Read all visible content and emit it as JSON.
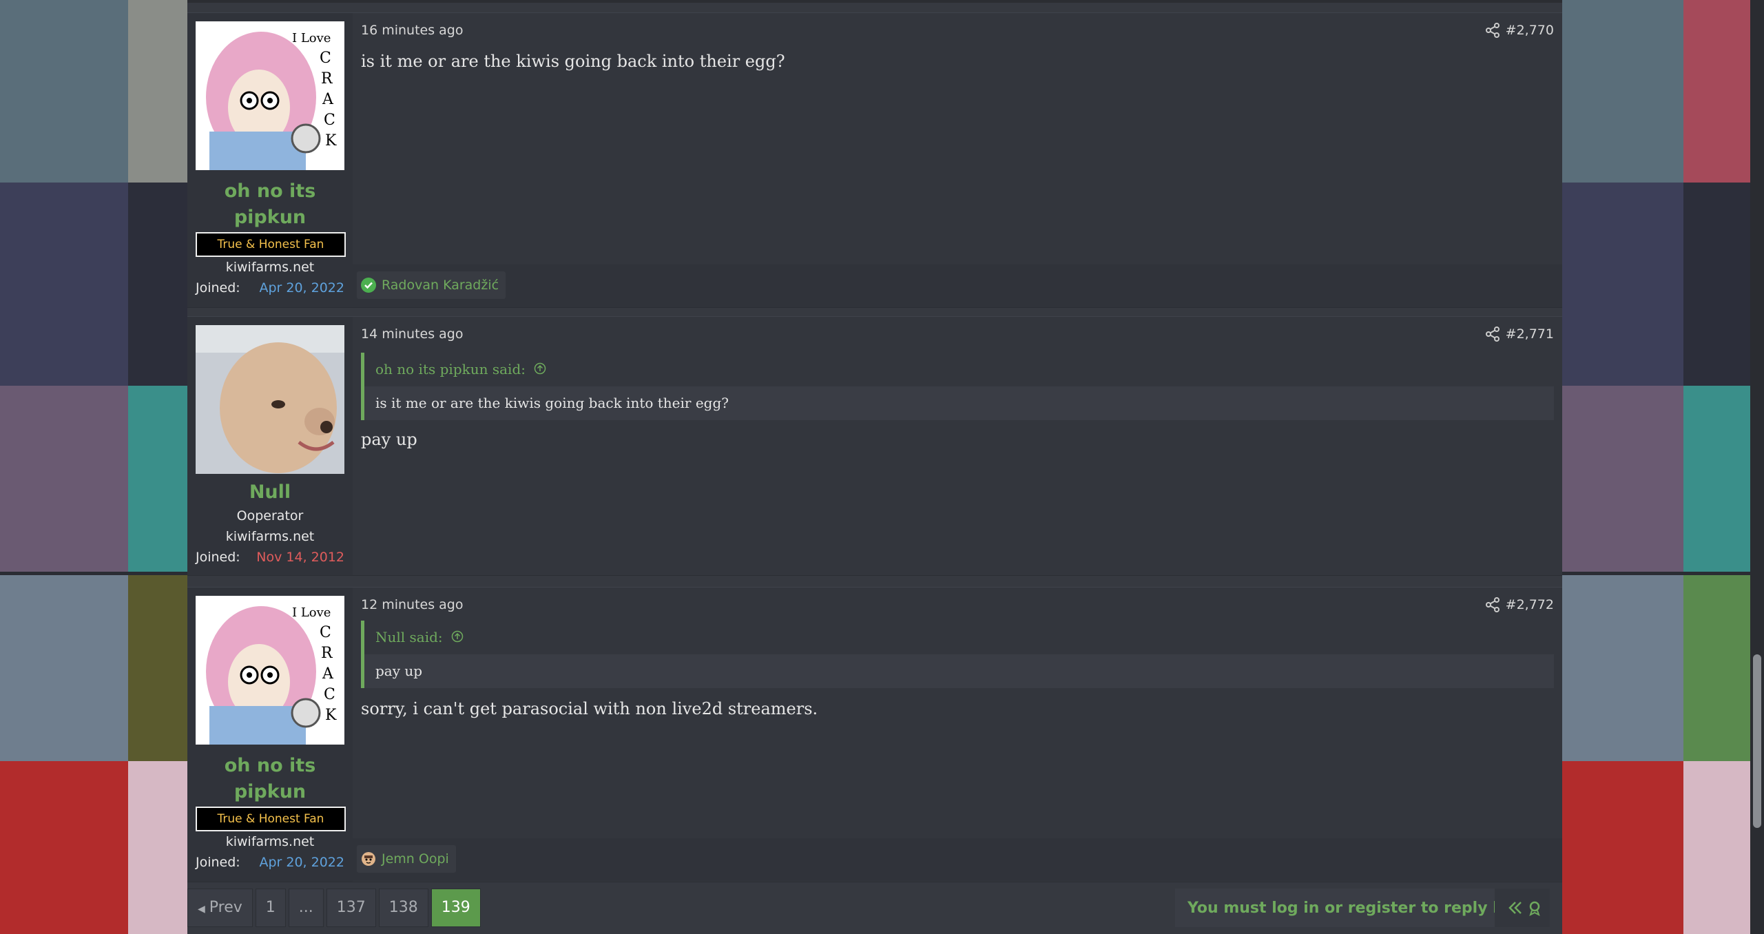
{
  "posts": [
    {
      "author": "oh no its pipkun",
      "author_line1": "oh no its",
      "author_line2": "pipkun",
      "badge": "True & Honest Fan",
      "site": "kiwifarms.net",
      "joined_label": "Joined:",
      "joined": "Apr 20, 2022",
      "joined_color": "#5fa2dd",
      "time": "16 minutes ago",
      "post_number": "#2,770",
      "text": "is it me or are the kiwis going back into their egg?",
      "reaction": {
        "icon": "check-circle-icon",
        "name": "Radovan Karadžić"
      }
    },
    {
      "author": "Null",
      "rank": "Ooperator",
      "site": "kiwifarms.net",
      "joined_label": "Joined:",
      "joined": "Nov 14, 2012",
      "joined_color": "#e05c5c",
      "time": "14 minutes ago",
      "post_number": "#2,771",
      "quote": {
        "author": "oh no its pipkun said:",
        "text": "is it me or are the kiwis going back into their egg?"
      },
      "text": "pay up"
    },
    {
      "author": "oh no its pipkun",
      "author_line1": "oh no its",
      "author_line2": "pipkun",
      "badge": "True & Honest Fan",
      "site": "kiwifarms.net",
      "joined_label": "Joined:",
      "joined": "Apr 20, 2022",
      "joined_color": "#5fa2dd",
      "time": "12 minutes ago",
      "post_number": "#2,772",
      "quote": {
        "author": "Null said:",
        "text": "pay up"
      },
      "text": "sorry, i can't get parasocial with non live2d streamers.",
      "reaction": {
        "icon": "face-emoji-icon",
        "name": "Jemn Oopi"
      }
    }
  ],
  "pagination": {
    "prev": "Prev",
    "pages": [
      "1",
      "...",
      "137",
      "138",
      "139"
    ],
    "current": "139"
  },
  "reply_notice": "You must log in or register to reply here.",
  "colors": {
    "accent": "#6faa5d",
    "background": "#363940"
  }
}
